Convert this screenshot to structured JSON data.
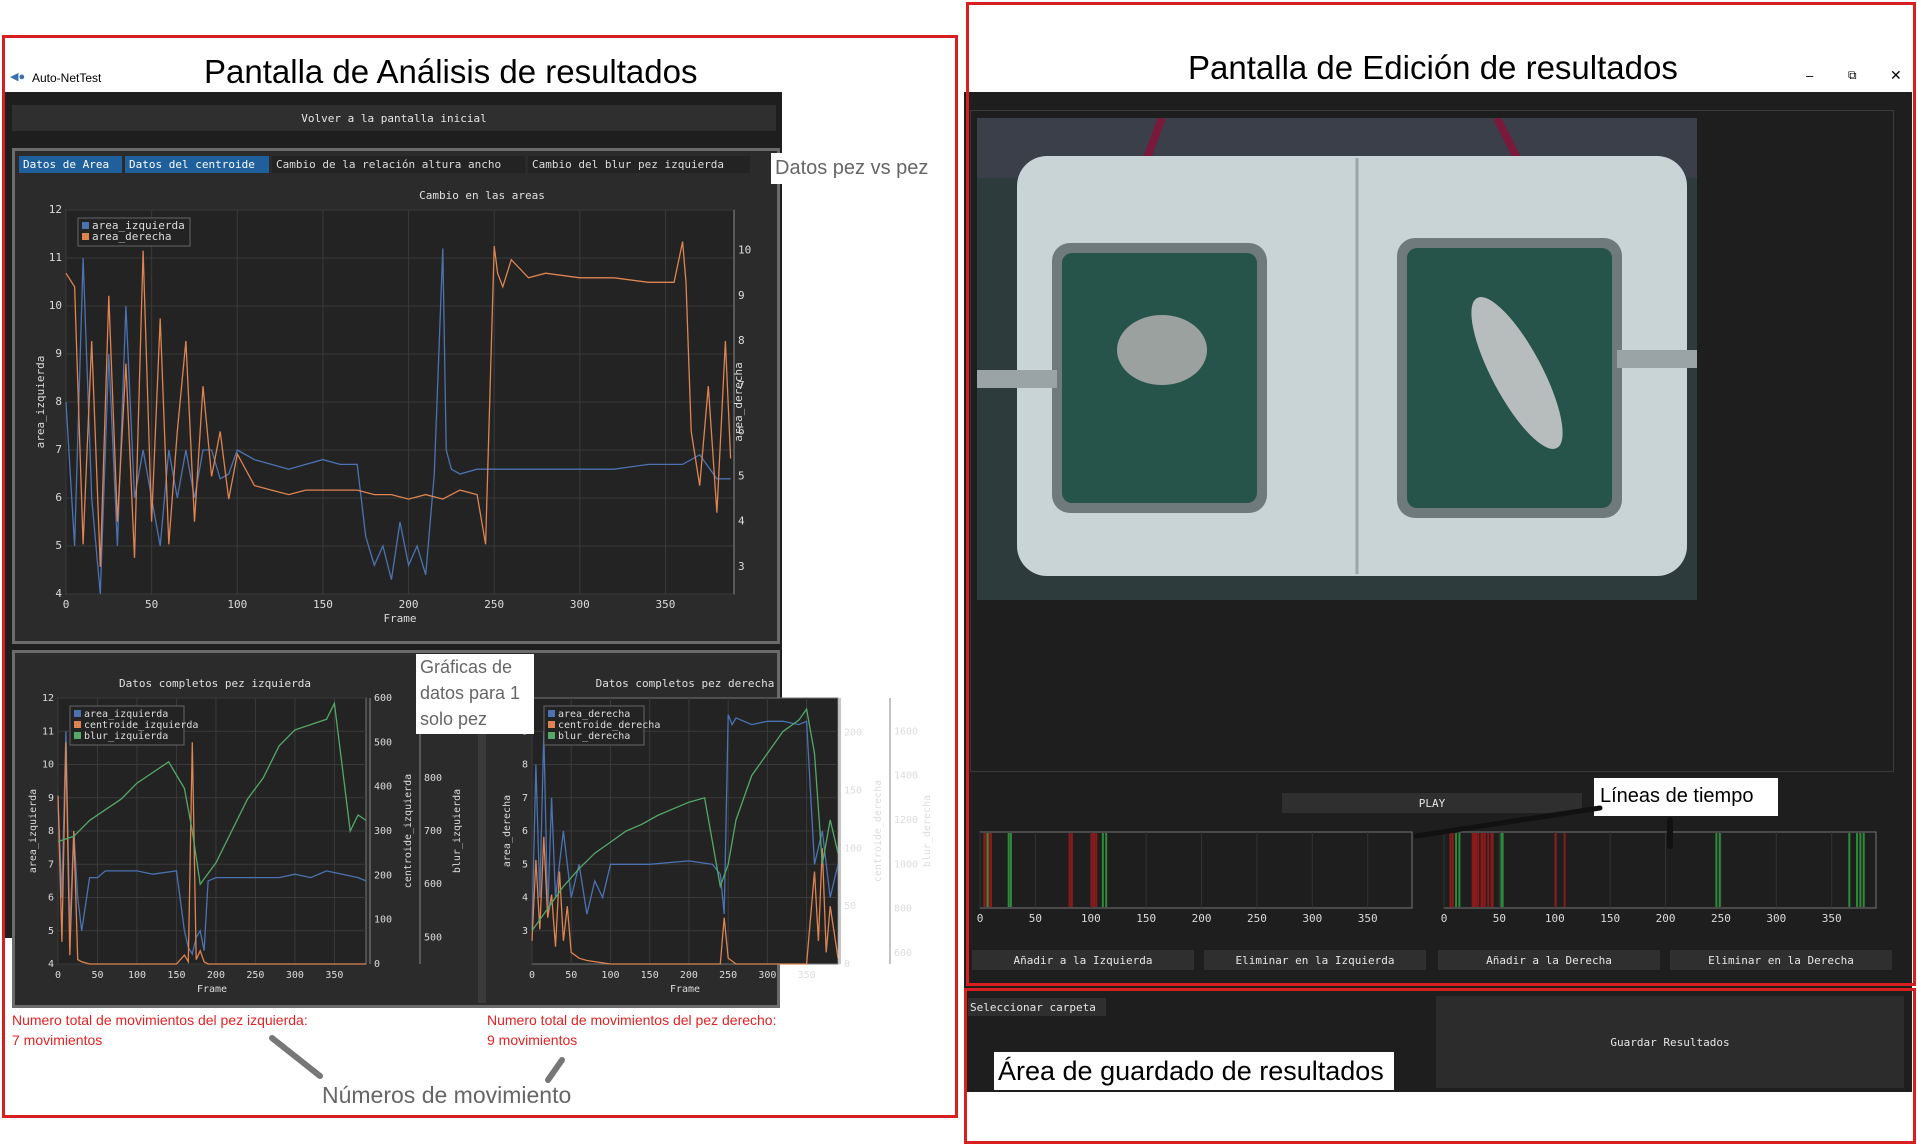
{
  "annotations": {
    "analysis_title": "Pantalla de Análisis de resultados",
    "edition_title": "Pantalla de Edición de resultados",
    "pez_vs_pez": "Datos pez vs pez",
    "single_fish_graphs": "Gráficas de datos para 1 solo pez",
    "timelines": "Líneas de tiempo",
    "movement_numbers": "Números de movimiento",
    "save_area": "Área de guardado de resultados"
  },
  "app": {
    "title": "Auto-NetTest",
    "icon": "fish-icon",
    "window_controls": [
      "minimize-icon",
      "restore-icon",
      "close-icon"
    ]
  },
  "analysis": {
    "back_button": "Volver a la pantalla inicial",
    "tabs": [
      {
        "label": "Datos de Area",
        "active": true
      },
      {
        "label": "Datos del centroide",
        "active": true
      },
      {
        "label": "Cambio de la relación altura ancho",
        "active": false
      },
      {
        "label": "Cambio del blur pez izquierda",
        "active": false
      }
    ],
    "left_fish_movements_label": "Numero total de movimientos del pez izquierda:",
    "left_fish_movements_value": "7 movimientos",
    "right_fish_movements_label": "Numero total de movimientos del pez derecho:",
    "right_fish_movements_value": "9 movimientos"
  },
  "edition": {
    "play_button": "PLAY",
    "add_left": "Añadir a la Izquierda",
    "remove_left": "Eliminar en la Izquierda",
    "add_right": "Añadir a la Derecha",
    "remove_right": "Eliminar en la Derecha",
    "select_folder": "Seleccionar carpeta",
    "save_results": "Guardar Resultados",
    "timeline_ticks": [
      "0",
      "50",
      "100",
      "150",
      "200",
      "250",
      "300",
      "350"
    ],
    "left_timeline_marks": {
      "red": [
        3,
        5,
        7,
        9,
        80,
        82,
        100,
        102,
        104
      ],
      "green": [
        6,
        25,
        27,
        110,
        113
      ]
    },
    "right_timeline_marks": {
      "red": [
        5,
        7,
        25,
        26,
        27,
        28,
        30,
        33,
        34,
        36,
        39,
        42,
        43,
        100,
        108
      ],
      "green": [
        10,
        13,
        51,
        52,
        245,
        248,
        365,
        372,
        375,
        378
      ]
    }
  },
  "colors": {
    "blue": "#4c72b0",
    "orange": "#dd8452",
    "green": "#55a868",
    "red_mark": "#8b1a1a",
    "green_mark": "#2e8b3a",
    "accent_tab": "#1f5f9c",
    "annotation_red": "#d81e1e"
  },
  "chart_data": [
    {
      "type": "line",
      "title": "Cambio en las areas",
      "xlabel": "Frame",
      "ylabel": "area_izquierda",
      "y2label": "area_derecha",
      "xlim": [
        0,
        390
      ],
      "ylim": [
        4,
        12
      ],
      "y2lim": [
        2.4,
        10.9
      ],
      "xticks": [
        0,
        50,
        100,
        150,
        200,
        250,
        300,
        350
      ],
      "yticks": [
        4,
        5,
        6,
        7,
        8,
        9,
        10,
        11,
        12
      ],
      "y2ticks": [
        3,
        4,
        5,
        6,
        7,
        8,
        9,
        10
      ],
      "legend": "top-left",
      "grid": true,
      "series": [
        {
          "name": "area_izquierda",
          "axis": "left",
          "x": [
            0,
            5,
            10,
            15,
            20,
            25,
            30,
            35,
            40,
            45,
            50,
            55,
            60,
            65,
            70,
            75,
            80,
            85,
            90,
            95,
            100,
            110,
            120,
            130,
            140,
            150,
            160,
            170,
            175,
            180,
            185,
            190,
            195,
            200,
            205,
            210,
            215,
            220,
            222,
            225,
            230,
            240,
            250,
            260,
            280,
            300,
            320,
            340,
            360,
            370,
            380,
            388
          ],
          "y": [
            8,
            5,
            11,
            6,
            4,
            9,
            5,
            10,
            6,
            7,
            6,
            5,
            7,
            6,
            7,
            6,
            7,
            7,
            6.4,
            6.5,
            7,
            6.8,
            6.7,
            6.6,
            6.7,
            6.8,
            6.7,
            6.7,
            5.2,
            4.6,
            5,
            4.3,
            5.5,
            4.6,
            5,
            4.4,
            6.5,
            11.2,
            7,
            6.6,
            6.5,
            6.6,
            6.6,
            6.6,
            6.6,
            6.6,
            6.6,
            6.7,
            6.7,
            6.9,
            6.4,
            6.4
          ]
        },
        {
          "name": "area_derecha",
          "axis": "right",
          "x": [
            0,
            5,
            10,
            15,
            20,
            25,
            30,
            35,
            40,
            45,
            50,
            55,
            60,
            65,
            70,
            75,
            80,
            85,
            90,
            95,
            100,
            110,
            120,
            130,
            140,
            150,
            160,
            170,
            180,
            190,
            200,
            210,
            220,
            230,
            240,
            245,
            250,
            252,
            255,
            260,
            270,
            280,
            300,
            320,
            340,
            355,
            360,
            362,
            365,
            370,
            375,
            380,
            385,
            388
          ],
          "y": [
            9.5,
            9.2,
            3.5,
            8,
            3,
            9,
            4,
            7.5,
            3.2,
            10,
            4,
            8.5,
            3.5,
            6,
            8,
            4,
            7,
            5,
            6,
            4.5,
            5.5,
            4.8,
            4.7,
            4.6,
            4.7,
            4.7,
            4.7,
            4.7,
            4.6,
            4.6,
            4.5,
            4.6,
            4.5,
            4.7,
            4.6,
            3.5,
            10.1,
            9.5,
            9.2,
            9.8,
            9.4,
            9.5,
            9.4,
            9.4,
            9.3,
            9.3,
            10.2,
            9.3,
            6,
            4.8,
            7,
            4.2,
            8,
            5.4
          ]
        }
      ]
    },
    {
      "type": "line",
      "title": "Datos completos pez izquierda",
      "xlabel": "Frame",
      "ylabel": "area_izquierda",
      "y2label": "centroide_izquierda",
      "y3label": "blur_izquierda",
      "xlim": [
        0,
        390
      ],
      "ylim": [
        4,
        12
      ],
      "y2lim": [
        0,
        600
      ],
      "y3lim": [
        450,
        950
      ],
      "xticks": [
        0,
        50,
        100,
        150,
        200,
        250,
        300,
        350
      ],
      "yticks": [
        4,
        5,
        6,
        7,
        8,
        9,
        10,
        11,
        12
      ],
      "y2ticks": [
        0,
        100,
        200,
        300,
        400,
        500,
        600
      ],
      "y3ticks": [
        500,
        600,
        700,
        800
      ],
      "legend": "top-left",
      "grid": true,
      "series": [
        {
          "name": "area_izquierda",
          "axis": "left",
          "x": [
            0,
            5,
            10,
            15,
            20,
            25,
            30,
            40,
            50,
            60,
            80,
            100,
            120,
            150,
            160,
            165,
            170,
            175,
            180,
            185,
            190,
            200,
            220,
            250,
            280,
            300,
            320,
            340,
            360,
            380,
            390
          ],
          "y": [
            9,
            6,
            11,
            5,
            8,
            6,
            5,
            6.6,
            6.6,
            6.8,
            6.8,
            6.8,
            6.7,
            6.8,
            5,
            4.5,
            4.3,
            4.8,
            5,
            4.4,
            6.5,
            6.6,
            6.6,
            6.6,
            6.6,
            6.7,
            6.6,
            6.8,
            6.7,
            6.6,
            6.5
          ]
        },
        {
          "name": "centroide_izquierda",
          "axis": "right",
          "x": [
            0,
            5,
            10,
            15,
            20,
            25,
            30,
            40,
            60,
            80,
            100,
            150,
            160,
            165,
            170,
            175,
            180,
            185,
            190,
            200,
            250,
            300,
            350,
            390
          ],
          "y": [
            380,
            50,
            500,
            20,
            300,
            10,
            5,
            0,
            0,
            0,
            0,
            0,
            20,
            5,
            500,
            10,
            30,
            5,
            0,
            0,
            0,
            0,
            0,
            0
          ]
        },
        {
          "name": "blur_izquierda",
          "axis": "right2",
          "x": [
            0,
            20,
            40,
            60,
            80,
            100,
            120,
            140,
            160,
            170,
            180,
            200,
            220,
            240,
            260,
            280,
            300,
            340,
            350,
            360,
            370,
            380,
            390
          ],
          "y": [
            680,
            690,
            720,
            740,
            760,
            790,
            810,
            830,
            780,
            700,
            600,
            640,
            700,
            760,
            800,
            860,
            890,
            910,
            940,
            820,
            700,
            730,
            720
          ]
        }
      ]
    },
    {
      "type": "line",
      "title": "Datos completos pez derecha",
      "xlabel": "Frame",
      "ylabel": "area_derecha",
      "y2label": "centroide_derecha",
      "y3label": "blur_derecha",
      "xlim": [
        0,
        390
      ],
      "ylim": [
        2,
        10
      ],
      "y2lim": [
        0,
        230
      ],
      "y3lim": [
        550,
        1750
      ],
      "xticks": [
        0,
        50,
        100,
        150,
        200,
        250,
        300,
        350
      ],
      "yticks": [
        3,
        4,
        5,
        6,
        7,
        8,
        9
      ],
      "y2ticks": [
        0,
        50,
        100,
        150,
        200
      ],
      "y3ticks": [
        600,
        800,
        1000,
        1200,
        1400,
        1600
      ],
      "legend": "top-left",
      "grid": true,
      "series": [
        {
          "name": "area_derecha",
          "axis": "left",
          "x": [
            0,
            5,
            10,
            15,
            20,
            25,
            30,
            40,
            50,
            60,
            70,
            80,
            90,
            100,
            120,
            150,
            200,
            230,
            240,
            245,
            250,
            255,
            260,
            280,
            300,
            320,
            340,
            350,
            360,
            370,
            380,
            390
          ],
          "y": [
            3,
            8,
            4,
            9,
            3.5,
            7,
            4,
            6,
            4,
            5,
            3.5,
            4.5,
            4,
            5,
            5,
            5,
            5.1,
            5,
            4.7,
            3.5,
            9.5,
            9.2,
            9.4,
            9.2,
            9.3,
            9.3,
            9.2,
            9.3,
            5,
            6,
            4,
            5
          ]
        },
        {
          "name": "centroide_derecha",
          "axis": "right",
          "x": [
            0,
            5,
            10,
            15,
            20,
            25,
            30,
            35,
            40,
            45,
            50,
            60,
            70,
            100,
            150,
            200,
            240,
            245,
            250,
            260,
            300,
            350,
            360,
            365,
            370,
            375,
            380,
            390
          ],
          "y": [
            20,
            90,
            30,
            110,
            40,
            60,
            15,
            80,
            20,
            50,
            10,
            5,
            3,
            0,
            0,
            0,
            0,
            40,
            5,
            0,
            0,
            0,
            80,
            20,
            100,
            10,
            50,
            5
          ]
        },
        {
          "name": "blur_derecha",
          "axis": "right2",
          "x": [
            0,
            20,
            40,
            60,
            80,
            100,
            120,
            140,
            160,
            180,
            200,
            220,
            230,
            240,
            250,
            260,
            280,
            300,
            320,
            340,
            350,
            360,
            370,
            380,
            390
          ],
          "y": [
            700,
            800,
            900,
            980,
            1050,
            1100,
            1150,
            1180,
            1220,
            1250,
            1280,
            1300,
            1100,
            900,
            1000,
            1200,
            1400,
            1500,
            1600,
            1650,
            1700,
            1500,
            1000,
            1200,
            1050
          ]
        }
      ]
    }
  ]
}
